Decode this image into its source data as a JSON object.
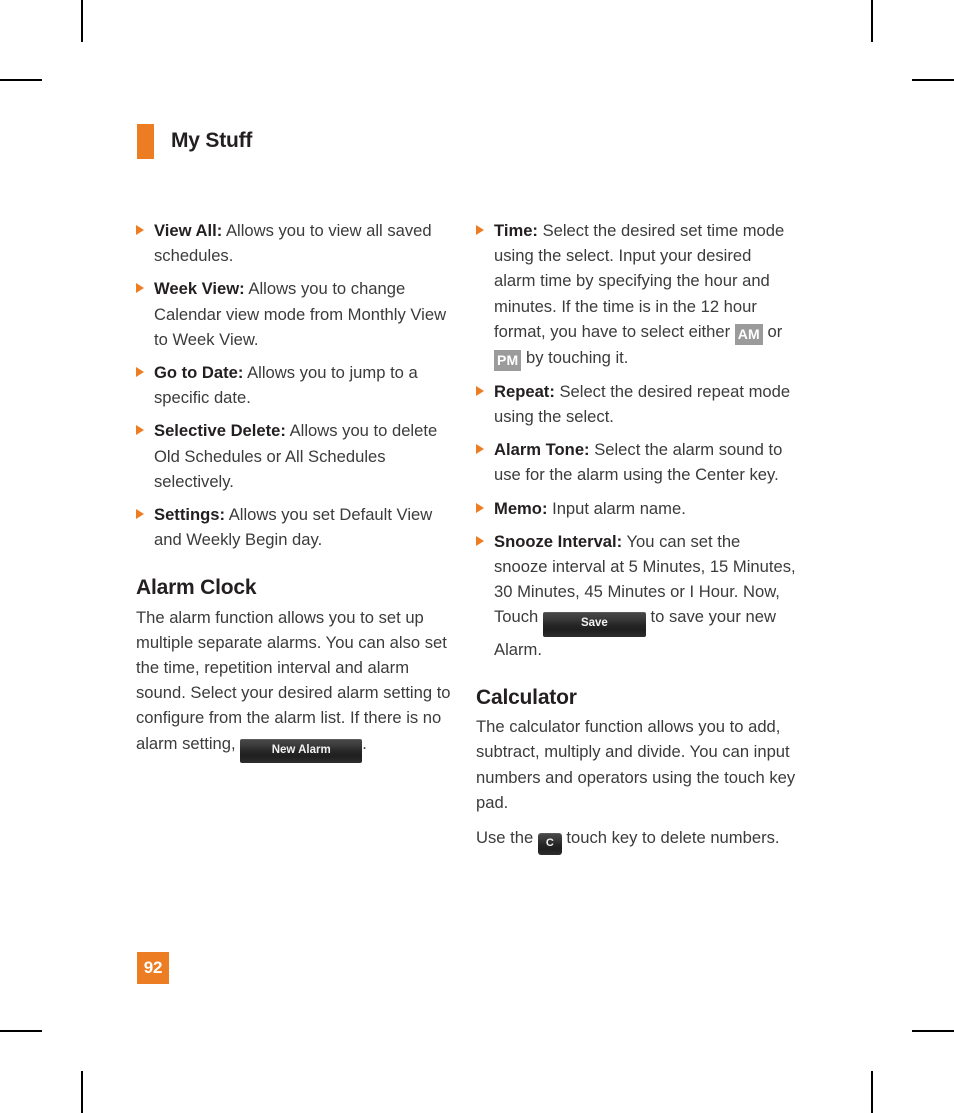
{
  "document": {
    "running_head": "My Stuff",
    "page_number": "92"
  },
  "colors": {
    "accent_orange": "#ED7D23",
    "body_text": "#3b3b3b",
    "heading_text": "#231f20",
    "chip_gray": "#9b9b9b",
    "chip_key_dark": "#262626"
  },
  "left_column": {
    "bullets": [
      {
        "term": "View All:",
        "text": " Allows you to view all saved schedules."
      },
      {
        "term": "Week View:",
        "text": " Allows you to change Calendar view mode from Monthly View to Week View."
      },
      {
        "term": "Go to Date:",
        "text": " Allows you to jump to a specific date."
      },
      {
        "term": "Selective Delete:",
        "text": " Allows you to delete Old Schedules or All Schedules selectively."
      },
      {
        "term": "Settings:",
        "text": " Allows you set Default View and Weekly Begin day."
      }
    ],
    "section": {
      "heading": "Alarm Clock",
      "paragraph_before_key": "The alarm function allows you to set up multiple separate alarms. You can also set the time, repetition interval and alarm sound. Select your desired alarm setting to configure from the alarm list. If there is no alarm setting, ",
      "key_label": "New Alarm",
      "paragraph_after_key": "."
    }
  },
  "right_column": {
    "bullets": [
      {
        "term": "Time:",
        "text_part1": " Select the desired set time mode using the select. Input your desired alarm time by specifying the hour and minutes. If the time is in the 12 hour format, you have to select either ",
        "tag_am": "AM",
        "text_part2": " or ",
        "tag_pm": "PM",
        "text_part3": " by touching it."
      },
      {
        "term": "Repeat:",
        "text": " Select the desired repeat mode using the select."
      },
      {
        "term": "Alarm Tone:",
        "text": " Select the alarm sound to use for the alarm using the Center key."
      },
      {
        "term": "Memo:",
        "text": " Input alarm name."
      },
      {
        "term": "Snooze Interval:",
        "text_part1": " You can set the snooze interval at 5 Minutes, 15 Minutes, 30 Minutes, 45 Minutes or I Hour. Now, Touch ",
        "key_label": "Save",
        "text_part2": " to save your new Alarm."
      }
    ],
    "section": {
      "heading": "Calculator",
      "paragraph1": "The calculator function allows you to add, subtract, multiply and divide. You can input numbers and operators using the touch key pad.",
      "paragraph2_before_key": "Use the ",
      "key_label": "C",
      "paragraph2_after_key": " touch key to delete numbers."
    }
  }
}
